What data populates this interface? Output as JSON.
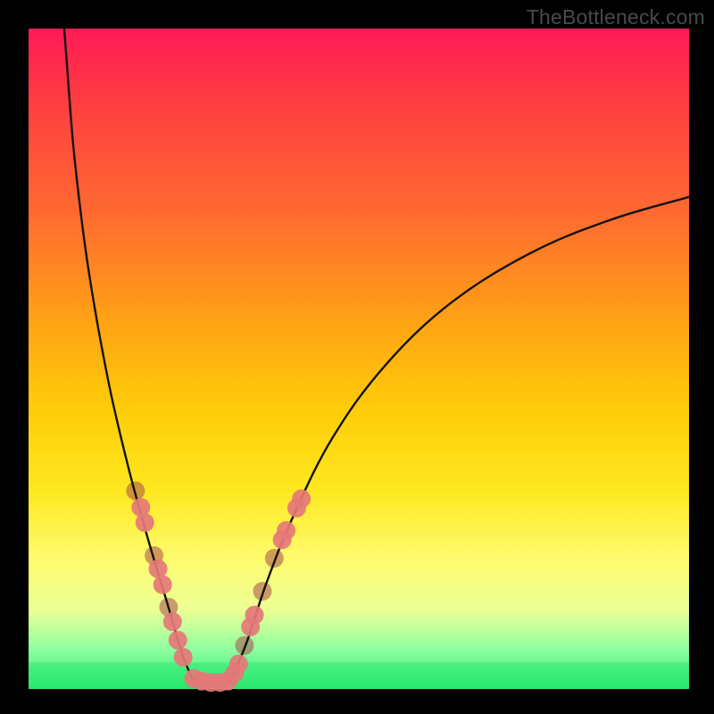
{
  "watermark": "TheBottleneck.com",
  "colors": {
    "dot_front": "#e57878",
    "dot_behind": "#a84b4b",
    "curve": "#131313"
  },
  "chart_data": {
    "type": "line",
    "title": "",
    "xlabel": "",
    "ylabel": "",
    "xlim": [
      0,
      100
    ],
    "ylim": [
      0,
      100
    ],
    "series": [
      {
        "name": "bottleneck-curve-left",
        "x": [
          5.4,
          6,
          7,
          9,
          12,
          15,
          18,
          21,
          23.2,
          25.1
        ],
        "values": [
          100,
          92,
          80,
          64,
          47,
          34,
          23,
          13,
          5.5,
          0.8
        ]
      },
      {
        "name": "bottleneck-curve-right",
        "x": [
          30.4,
          33,
          36,
          40,
          46,
          54,
          64,
          76,
          88,
          100
        ],
        "values": [
          0.8,
          7,
          16,
          26,
          38,
          49,
          58.5,
          66,
          71,
          74.5
        ]
      },
      {
        "name": "bottleneck-floor",
        "x": [
          25.1,
          30.4
        ],
        "values": [
          0.8,
          0.8
        ]
      }
    ],
    "safe_band_y": [
      0,
      4
    ],
    "points": [
      {
        "x": 16.2,
        "y": 30.0,
        "layer": "behind"
      },
      {
        "x": 17.0,
        "y": 27.5,
        "layer": "front"
      },
      {
        "x": 17.6,
        "y": 25.2,
        "layer": "front"
      },
      {
        "x": 19.0,
        "y": 20.2,
        "layer": "behind"
      },
      {
        "x": 19.6,
        "y": 18.2,
        "layer": "front"
      },
      {
        "x": 20.3,
        "y": 15.8,
        "layer": "front"
      },
      {
        "x": 21.2,
        "y": 12.4,
        "layer": "behind"
      },
      {
        "x": 21.8,
        "y": 10.2,
        "layer": "front"
      },
      {
        "x": 22.6,
        "y": 7.4,
        "layer": "front"
      },
      {
        "x": 23.4,
        "y": 4.8,
        "layer": "front"
      },
      {
        "x": 25.0,
        "y": 1.6,
        "layer": "front"
      },
      {
        "x": 26.2,
        "y": 1.2,
        "layer": "front"
      },
      {
        "x": 27.6,
        "y": 1.0,
        "layer": "front"
      },
      {
        "x": 29.0,
        "y": 1.0,
        "layer": "front"
      },
      {
        "x": 30.2,
        "y": 1.2,
        "layer": "front"
      },
      {
        "x": 31.2,
        "y": 2.4,
        "layer": "front"
      },
      {
        "x": 31.8,
        "y": 3.8,
        "layer": "front"
      },
      {
        "x": 32.7,
        "y": 6.6,
        "layer": "behind"
      },
      {
        "x": 33.6,
        "y": 9.4,
        "layer": "front"
      },
      {
        "x": 34.2,
        "y": 11.2,
        "layer": "front"
      },
      {
        "x": 35.4,
        "y": 14.8,
        "layer": "behind"
      },
      {
        "x": 37.2,
        "y": 19.8,
        "layer": "behind"
      },
      {
        "x": 38.4,
        "y": 22.6,
        "layer": "front"
      },
      {
        "x": 39.0,
        "y": 24.0,
        "layer": "front"
      },
      {
        "x": 40.6,
        "y": 27.4,
        "layer": "front"
      },
      {
        "x": 41.3,
        "y": 28.8,
        "layer": "front"
      }
    ]
  }
}
